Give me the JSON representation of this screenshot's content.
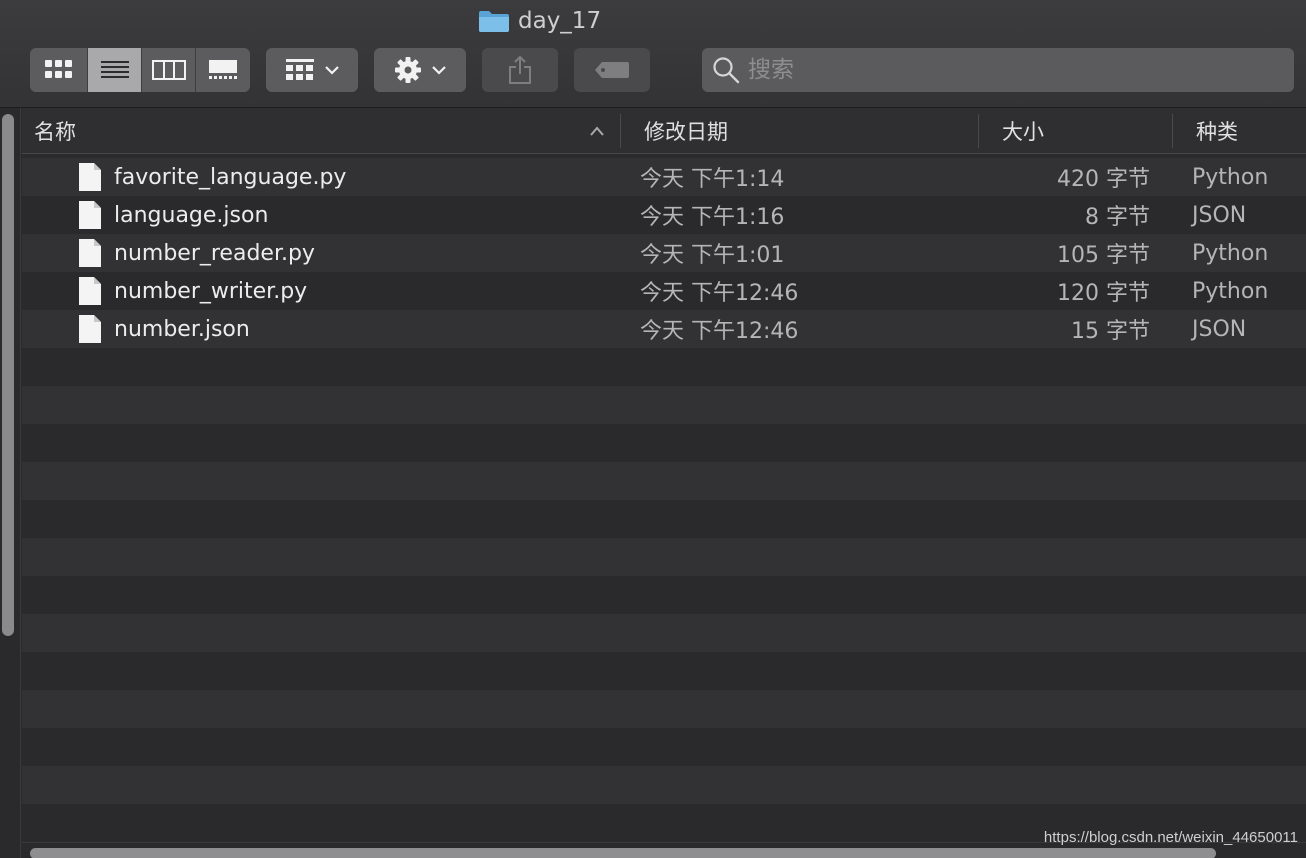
{
  "window": {
    "title": "day_17"
  },
  "toolbar": {
    "view_buttons": [
      {
        "name": "icon-view",
        "icon": "grid-icon",
        "active": false
      },
      {
        "name": "list-view",
        "icon": "list-icon",
        "active": true
      },
      {
        "name": "column-view",
        "icon": "columns-icon",
        "active": false
      },
      {
        "name": "gallery-view",
        "icon": "gallery-icon",
        "active": false
      }
    ],
    "group_icon": "group-grid-icon",
    "action_icon": "gear-icon",
    "share_icon": "share-icon",
    "tag_icon": "tag-icon"
  },
  "search": {
    "placeholder": "搜索",
    "value": ""
  },
  "columns": {
    "name": "名称",
    "date": "修改日期",
    "size": "大小",
    "kind": "种类"
  },
  "files": [
    {
      "name": "favorite_language.py",
      "date": "今天 下午1:14",
      "size": "420 字节",
      "kind": "Python"
    },
    {
      "name": "language.json",
      "date": "今天 下午1:16",
      "size": "8 字节",
      "kind": "JSON"
    },
    {
      "name": "number_reader.py",
      "date": "今天 下午1:01",
      "size": "105 字节",
      "kind": "Python"
    },
    {
      "name": "number_writer.py",
      "date": "今天 下午12:46",
      "size": "120 字节",
      "kind": "Python"
    },
    {
      "name": "number.json",
      "date": "今天 下午12:46",
      "size": "15 字节",
      "kind": "JSON"
    }
  ],
  "watermark": "https://blog.csdn.net/weixin_44650011",
  "colors": {
    "folder": "#6fb3e0",
    "accent_active_segment": "#a9a9ab"
  }
}
